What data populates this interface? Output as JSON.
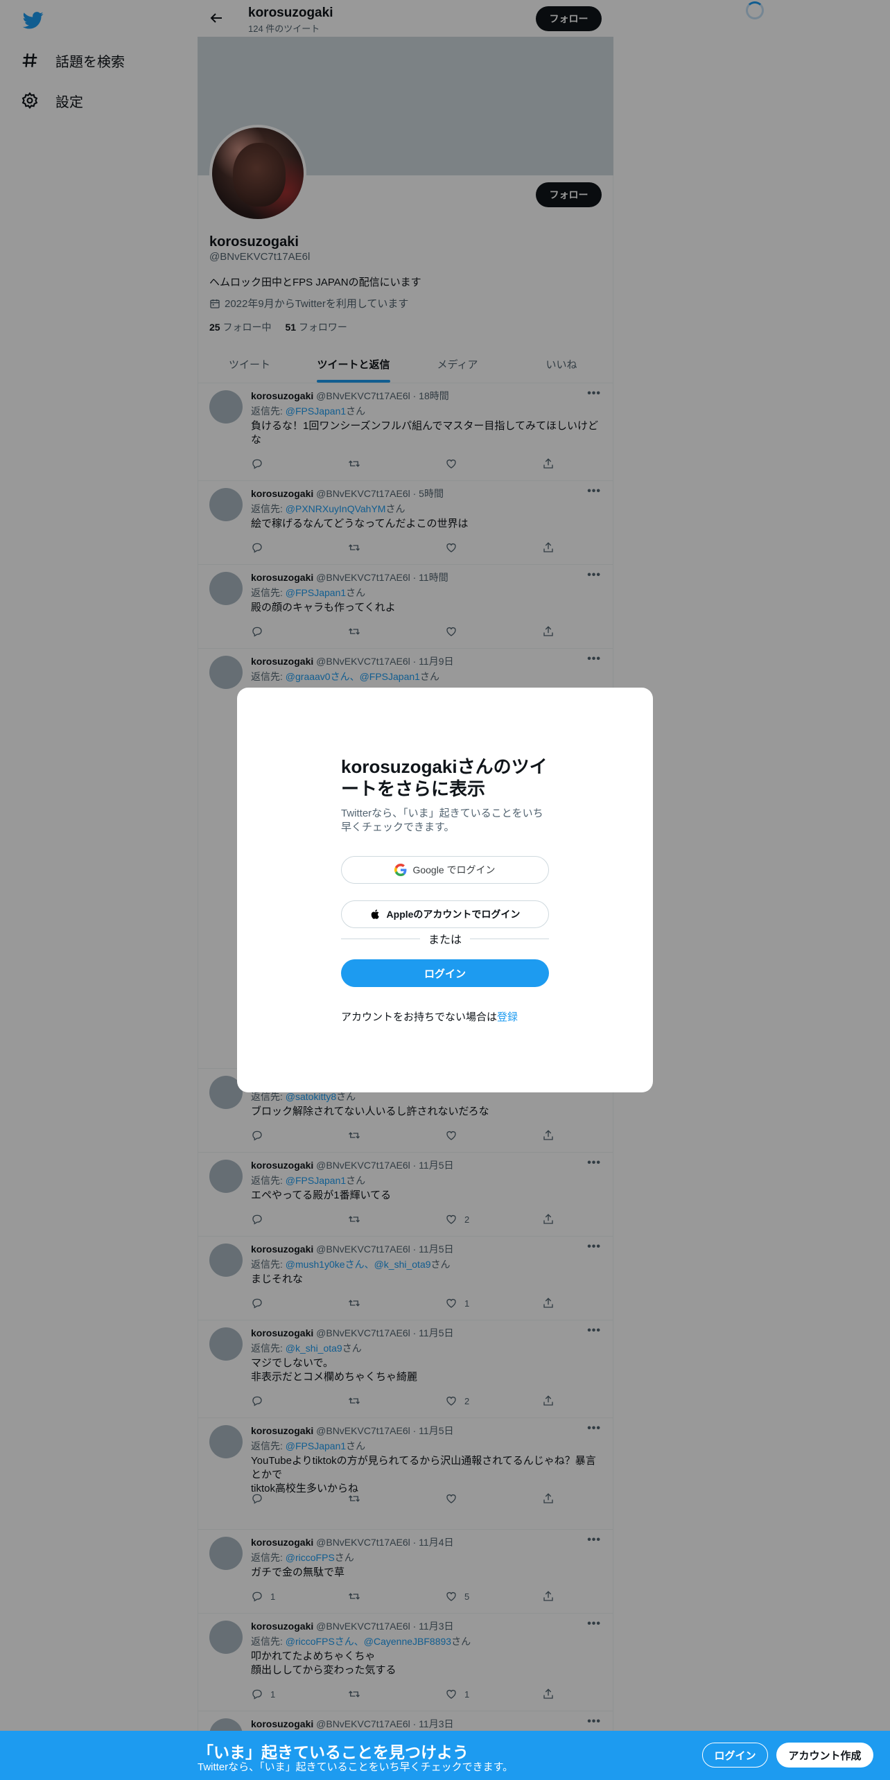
{
  "nav": {
    "logo": "twitter-bird-icon",
    "items": [
      {
        "label": "話題を検索",
        "icon": "hashtag-icon"
      },
      {
        "label": "設定",
        "icon": "gear-icon"
      }
    ]
  },
  "header": {
    "name": "korosuzogaki",
    "tweet_count": "124 件のツイート",
    "follow_label": "フォロー"
  },
  "profile": {
    "name": "korosuzogaki",
    "handle": "@BNvEKVC7t17AE6l",
    "bio": "ヘムロック田中とFPS JAPANの配信にいます",
    "joined": "2022年9月からTwitterを利用しています",
    "following_count": "25",
    "following_label": "フォロー中",
    "followers_count": "51",
    "followers_label": "フォロワー",
    "follow_label": "フォロー"
  },
  "tabs": [
    {
      "label": "ツイート",
      "active": false
    },
    {
      "label": "ツイートと返信",
      "active": true
    },
    {
      "label": "メディア",
      "active": false
    },
    {
      "label": "いいね",
      "active": false
    }
  ],
  "tweets": [
    {
      "name": "korosuzogaki",
      "meta": "@BNvEKVC7t17AE6l · 18時間",
      "reply_prefix": "返信先: ",
      "mentions": "@FPSJapan1",
      "reply_suffix": "さん",
      "text": "負けるな！1回ワンシーズンフルパ組んでマスター目指してみてほしいけどな",
      "reply_count": "",
      "retweet_count": "",
      "like_count": ""
    },
    {
      "name": "korosuzogaki",
      "meta": "@BNvEKVC7t17AE6l · 5時間",
      "reply_prefix": "返信先: ",
      "mentions": "@PXNRXuyInQVahYM",
      "reply_suffix": "さん",
      "text": "絵で稼げるなんてどうなってんだよこの世界は",
      "reply_count": "",
      "retweet_count": "",
      "like_count": ""
    },
    {
      "name": "korosuzogaki",
      "meta": "@BNvEKVC7t17AE6l · 11時間",
      "reply_prefix": "返信先: ",
      "mentions": "@FPSJapan1",
      "reply_suffix": "さん",
      "text": "殿の顔のキャラも作ってくれよ",
      "reply_count": "",
      "retweet_count": "",
      "like_count": ""
    },
    {
      "name": "korosuzogaki",
      "meta": "@BNvEKVC7t17AE6l · 11月9日",
      "reply_prefix": "返信先: ",
      "mentions": "@graaav0さん、@FPSJapan1",
      "reply_suffix": "さん",
      "text": "",
      "reply_count": "",
      "retweet_count": "",
      "like_count": ""
    },
    {
      "name": "",
      "meta": "",
      "reply_prefix": "返信先: ",
      "mentions": "@satokitty8",
      "reply_suffix": "さん",
      "text": "ブロック解除されてない人いるし許されないだろな",
      "reply_count": "",
      "retweet_count": "",
      "like_count": ""
    },
    {
      "name": "korosuzogaki",
      "meta": "@BNvEKVC7t17AE6l · 11月5日",
      "reply_prefix": "返信先: ",
      "mentions": "@FPSJapan1",
      "reply_suffix": "さん",
      "text": "エペやってる殿が1番輝いてる",
      "reply_count": "",
      "retweet_count": "",
      "like_count": "2"
    },
    {
      "name": "korosuzogaki",
      "meta": "@BNvEKVC7t17AE6l · 11月5日",
      "reply_prefix": "返信先: ",
      "mentions": "@mush1y0keさん、@k_shi_ota9",
      "reply_suffix": "さん",
      "text": "まじそれな",
      "reply_count": "",
      "retweet_count": "",
      "like_count": "1"
    },
    {
      "name": "korosuzogaki",
      "meta": "@BNvEKVC7t17AE6l · 11月5日",
      "reply_prefix": "返信先: ",
      "mentions": "@k_shi_ota9",
      "reply_suffix": "さん",
      "text": "マジでしないで。\n非表示だとコメ欄めちゃくちゃ綺麗",
      "reply_count": "",
      "retweet_count": "",
      "like_count": "2"
    },
    {
      "name": "korosuzogaki",
      "meta": "@BNvEKVC7t17AE6l · 11月5日",
      "reply_prefix": "返信先: ",
      "mentions": "@FPSJapan1",
      "reply_suffix": "さん",
      "text": "YouTubeよりtiktokの方が見られてるから沢山通報されてるんじゃね？暴言とかで\ntiktok高校生多いからね",
      "reply_count": "",
      "retweet_count": "",
      "like_count": ""
    },
    {
      "name": "korosuzogaki",
      "meta": "@BNvEKVC7t17AE6l · 11月4日",
      "reply_prefix": "返信先: ",
      "mentions": "@riccoFPS",
      "reply_suffix": "さん",
      "text": "ガチで金の無駄で草",
      "reply_count": "1",
      "retweet_count": "",
      "like_count": "5"
    },
    {
      "name": "korosuzogaki",
      "meta": "@BNvEKVC7t17AE6l · 11月3日",
      "reply_prefix": "返信先: ",
      "mentions": "@riccoFPSさん、@CayenneJBF8893",
      "reply_suffix": "さん",
      "text": "叩かれてたよめちゃくちゃ\n顔出ししてから変わった気する",
      "reply_count": "1",
      "retweet_count": "",
      "like_count": "1"
    },
    {
      "name": "korosuzogaki",
      "meta": "@BNvEKVC7t17AE6l · 11月3日",
      "reply_prefix": "",
      "mentions": "",
      "reply_suffix": "",
      "text": "",
      "reply_count": "",
      "retweet_count": "",
      "like_count": ""
    }
  ],
  "modal": {
    "title": "korosuzogakiさんのツイートをさらに表示",
    "subtitle": "Twitterなら、「いま」起きていることをいち早くチェックできます。",
    "google_label": "Google でログイン",
    "apple_label": "Appleのアカウントでログイン",
    "or_label": "または",
    "login_label": "ログイン",
    "signup_prompt": "アカウントをお持ちでない場合は",
    "signup_link": "登録"
  },
  "bottom_bar": {
    "title": "「いま」起きていることを見つけよう",
    "subtitle": "Twitterなら、「いま」起きていることをいち早くチェックできます。",
    "login_label": "ログイン",
    "signup_label": "アカウント作成"
  },
  "colors": {
    "accent": "#1d9bf0",
    "text": "#0f1419",
    "secondary": "#536471"
  }
}
